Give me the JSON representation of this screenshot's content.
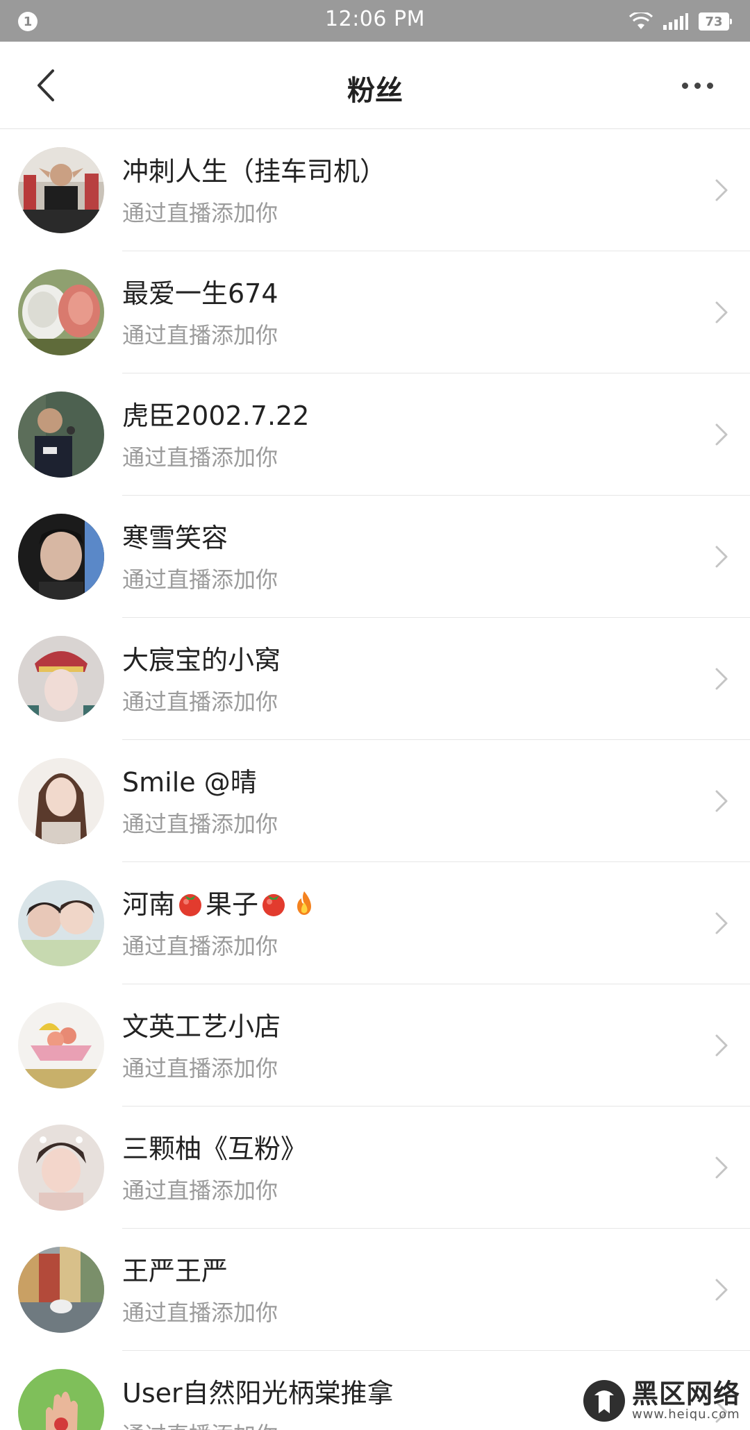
{
  "status_bar": {
    "notification_count": "1",
    "time": "12:06 PM",
    "battery": "73",
    "icons": [
      "wifi-icon",
      "signal-icon",
      "battery-icon"
    ]
  },
  "header": {
    "title": "粉丝",
    "back_icon": "chevron-left-icon",
    "more_icon": "more-dots-icon"
  },
  "fans": [
    {
      "name": "冲刺人生（挂车司机）",
      "subtitle": "通过直播添加你"
    },
    {
      "name": "最爱一生674",
      "subtitle": "通过直播添加你"
    },
    {
      "name": "虎臣2002.7.22",
      "subtitle": "通过直播添加你"
    },
    {
      "name": "寒雪笑容",
      "subtitle": "通过直播添加你"
    },
    {
      "name": "大宸宝的小窝",
      "subtitle": "通过直播添加你"
    },
    {
      "name": "Smile @晴",
      "subtitle": "通过直播添加你"
    },
    {
      "name_parts": [
        "河南",
        "果子"
      ],
      "name_emojis": [
        "tomato-emoji",
        "tomato-emoji",
        "fire-emoji"
      ],
      "subtitle": "通过直播添加你"
    },
    {
      "name": "文英工艺小店",
      "subtitle": "通过直播添加你"
    },
    {
      "name": "三颗柚《互粉》",
      "subtitle": "通过直播添加你"
    },
    {
      "name": "王严王严",
      "subtitle": "通过直播添加你"
    },
    {
      "name": "User自然阳光柄棠推拿",
      "subtitle": "通过直播添加你"
    }
  ],
  "watermark": {
    "text": "黑区网络",
    "url": "www.heiqu.com"
  },
  "colors": {
    "status_bar": "#9a9a9a",
    "subtitle": "#9b9b9b",
    "divider": "#e6e6e6"
  }
}
